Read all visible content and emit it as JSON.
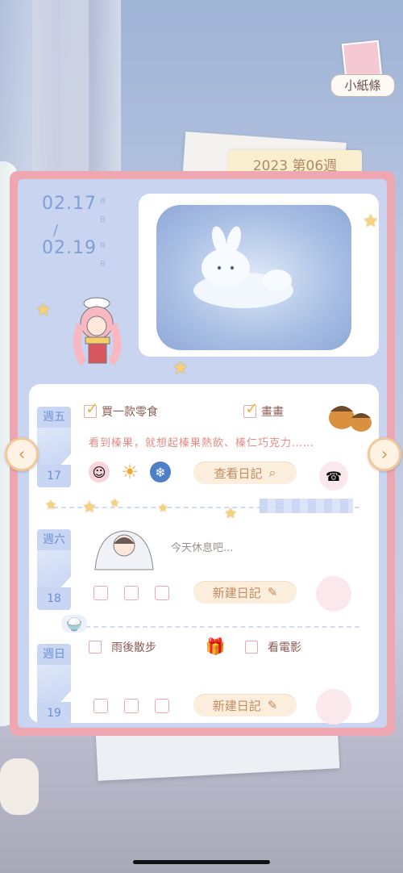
{
  "note_button": {
    "label": "小紙條",
    "icon": "note-paper-icon"
  },
  "journal": {
    "week_label": "2023 第06週",
    "date_range": {
      "start": "02.17",
      "end": "02.19",
      "slash": "/",
      "unit_month": "月",
      "unit_day": "日"
    }
  },
  "days": [
    {
      "weekday": "週五",
      "day": "17",
      "todos": [
        {
          "label": "買一款零食",
          "checked": true
        },
        {
          "label": "畫畫",
          "checked": true
        }
      ],
      "diary_excerpt": "看到榛果，就想起榛果熱飲、榛仁巧克力……",
      "action_label": "查看日記",
      "action_icon": "search-icon",
      "mood_icons": [
        "pink-face-icon",
        "sun-icon",
        "snow-globe-icon"
      ]
    },
    {
      "weekday": "週六",
      "day": "18",
      "note": "今天休息吧...",
      "action_label": "新建日記",
      "action_icon": "edit-icon"
    },
    {
      "weekday": "週日",
      "day": "19",
      "todos": [
        {
          "label": "雨後散步",
          "checked": false
        },
        {
          "label": "看電影",
          "checked": false
        }
      ],
      "action_label": "新建日記",
      "action_icon": "edit-icon"
    }
  ],
  "nav": {
    "prev_glyph": "‹",
    "next_glyph": "›"
  },
  "colors": {
    "accent": "#eea7b0",
    "blue": "#c9d5f0",
    "button": "#fbeedd"
  }
}
